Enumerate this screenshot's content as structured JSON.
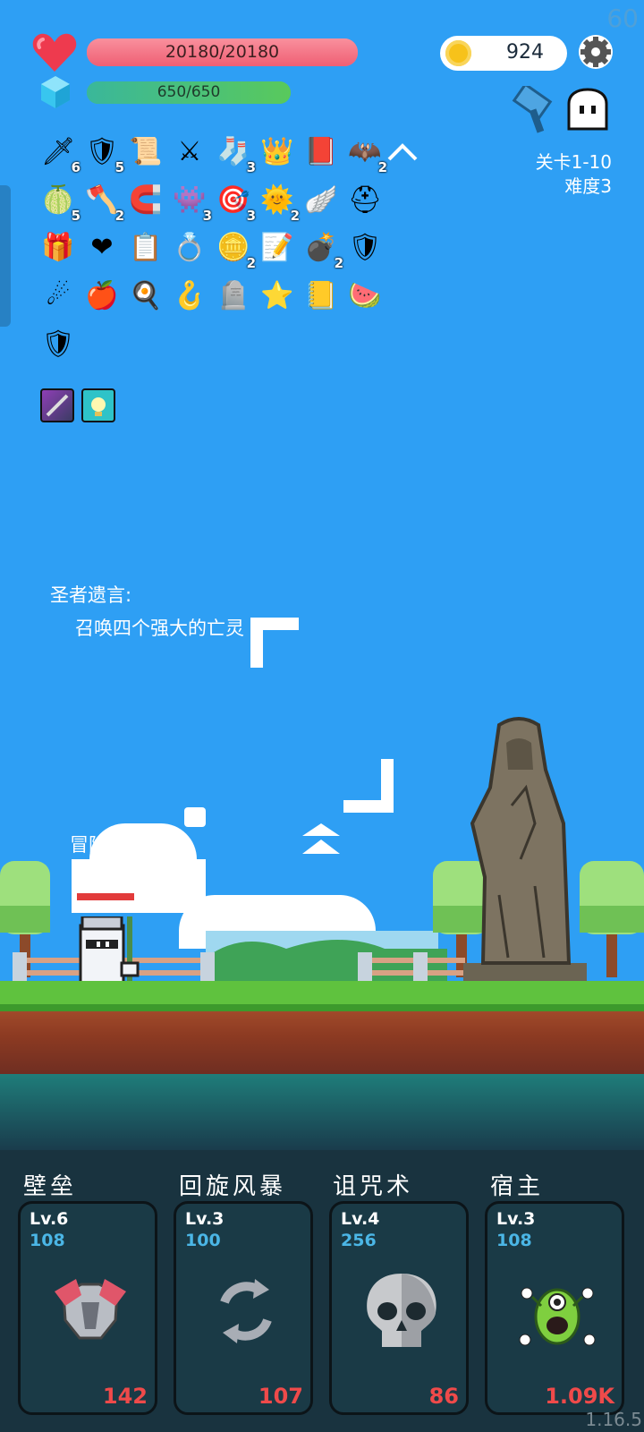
{
  "fps": "60",
  "player": {
    "hp": "20180/20180",
    "hp_fraction": 1.0,
    "mp": "650/650",
    "mp_fraction": 1.0
  },
  "coins": "924",
  "stage": {
    "level": "关卡1-10",
    "difficulty": "难度3"
  },
  "items": {
    "row1": [
      {
        "icon": "sword-icon",
        "count": "6"
      },
      {
        "icon": "round-shield-icon",
        "count": "5"
      },
      {
        "icon": "map-scroll-icon",
        "count": ""
      },
      {
        "icon": "broadsword-icon",
        "count": ""
      },
      {
        "icon": "red-sock-icon",
        "count": "3"
      },
      {
        "icon": "crown-icon",
        "count": ""
      },
      {
        "icon": "skull-book-icon",
        "count": ""
      },
      {
        "icon": "bat-icon",
        "count": "2"
      }
    ],
    "row2": [
      {
        "icon": "lime-icon",
        "count": "5"
      },
      {
        "icon": "battle-axe-icon",
        "count": "2"
      },
      {
        "icon": "magnet-icon",
        "count": ""
      },
      {
        "icon": "slime-monster-icon",
        "count": "3"
      },
      {
        "icon": "target-disc-icon",
        "count": "3"
      },
      {
        "icon": "sun-orb-icon",
        "count": "2"
      },
      {
        "icon": "angel-wing-icon",
        "count": ""
      },
      {
        "icon": "viking-helmet-icon",
        "count": ""
      }
    ],
    "row3": [
      {
        "icon": "gift-box-icon",
        "count": ""
      },
      {
        "icon": "heart-icon",
        "count": ""
      },
      {
        "icon": "clipboard-icon",
        "count": ""
      },
      {
        "icon": "ring-icon",
        "count": ""
      },
      {
        "icon": "coin-stack-icon",
        "count": "2"
      },
      {
        "icon": "checklist-icon",
        "count": ""
      },
      {
        "icon": "grenade-icon",
        "count": "2"
      },
      {
        "icon": "red-shield-icon",
        "count": ""
      }
    ],
    "row4": [
      {
        "icon": "meteor-icon",
        "count": ""
      },
      {
        "icon": "apple-icon",
        "count": ""
      },
      {
        "icon": "fried-egg-icon",
        "count": ""
      },
      {
        "icon": "hook-icon",
        "count": ""
      },
      {
        "icon": "tombstone-icon",
        "count": ""
      },
      {
        "icon": "star-card-icon",
        "count": ""
      },
      {
        "icon": "golden-book-icon",
        "count": ""
      },
      {
        "icon": "watermelon-icon",
        "count": ""
      }
    ],
    "row5": [
      {
        "icon": "guardian-shield-icon",
        "count": ""
      }
    ]
  },
  "story": {
    "speaker": "圣者遗言:",
    "line": "召唤四个强大的亡灵"
  },
  "adventure_label": "冒险",
  "skills": [
    {
      "name": "壁垒",
      "level": "Lv.6",
      "power": "108",
      "value": "142",
      "icon": "armor-icon"
    },
    {
      "name": "回旋风暴",
      "level": "Lv.3",
      "power": "100",
      "value": "107",
      "icon": "whirlwind-icon"
    },
    {
      "name": "诅咒术",
      "level": "Lv.4",
      "power": "256",
      "value": "86",
      "icon": "skull-icon"
    },
    {
      "name": "宿主",
      "level": "Lv.3",
      "power": "108",
      "value": "1.09K",
      "icon": "parasite-monster-icon"
    }
  ],
  "version": "1.16.5",
  "colors": {
    "sky": "#2e9ff4",
    "hp": "#f47a8a",
    "mp": "#4bc46a",
    "panel": "#19333f",
    "damage": "#ef4a4a",
    "power": "#4bb6e6"
  }
}
